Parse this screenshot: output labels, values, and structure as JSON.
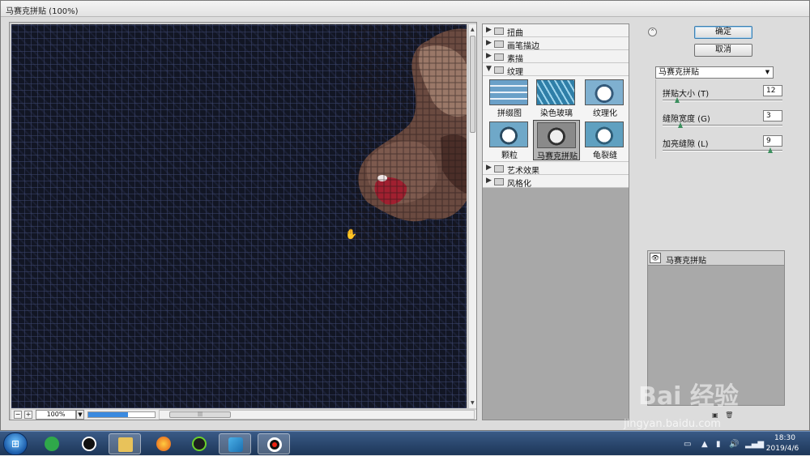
{
  "window": {
    "title": "马赛克拼贴 (100%)"
  },
  "preview": {
    "zoom": "100%",
    "progress": 0.6
  },
  "filter_categories_top": [
    {
      "label": "扭曲",
      "expanded": false
    },
    {
      "label": "画笔描边",
      "expanded": false
    },
    {
      "label": "素描",
      "expanded": false
    },
    {
      "label": "纹理",
      "expanded": true
    }
  ],
  "texture_filters": [
    {
      "label": "拼缀图",
      "selected": false
    },
    {
      "label": "染色玻璃",
      "selected": false
    },
    {
      "label": "纹理化",
      "selected": false
    },
    {
      "label": "颗粒",
      "selected": false
    },
    {
      "label": "马赛克拼贴",
      "selected": true
    },
    {
      "label": "龟裂缝",
      "selected": false
    }
  ],
  "filter_categories_bottom": [
    {
      "label": "艺术效果",
      "expanded": false
    },
    {
      "label": "风格化",
      "expanded": false
    }
  ],
  "buttons": {
    "ok": "确定",
    "cancel": "取消"
  },
  "selected_filter": "马赛克拼贴",
  "params": [
    {
      "label": "拼贴大小 (T)",
      "value": "12",
      "level": 0.12
    },
    {
      "label": "缝隙宽度 (G)",
      "value": "3",
      "level": 0.15
    },
    {
      "label": "加亮缝隙 (L)",
      "value": "9",
      "level": 0.9
    }
  ],
  "layer": {
    "name": "马赛克拼贴"
  },
  "taskbar": {
    "time": "18:30",
    "date": "2019/4/6",
    "apps": [
      "360-browser",
      "qq",
      "file-explorer",
      "firefox",
      "video-player",
      "photoshop-feather",
      "record"
    ]
  },
  "watermark": {
    "line1": "Bai 经验",
    "line2": "jingyan.baidu.com"
  }
}
